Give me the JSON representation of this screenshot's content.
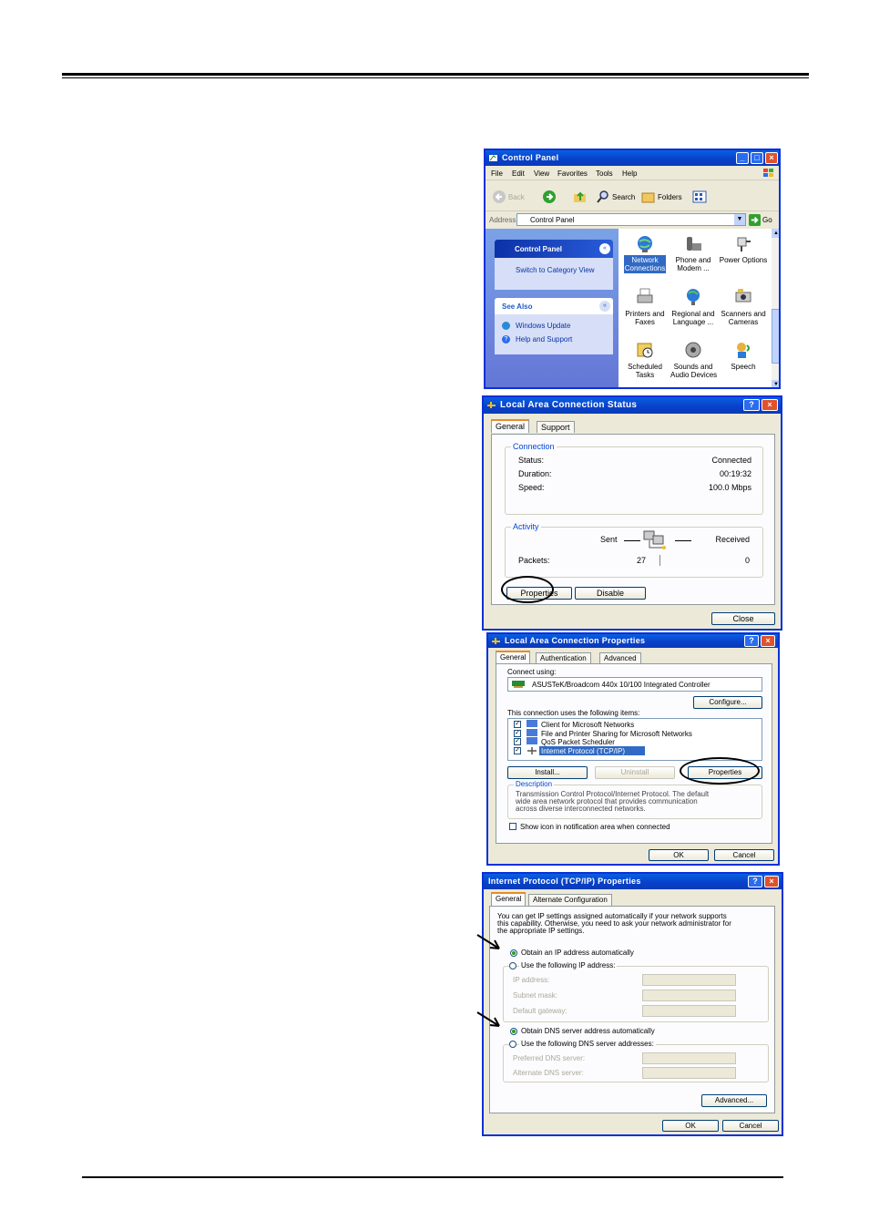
{
  "control_panel": {
    "title": "Control Panel",
    "menu": [
      "File",
      "Edit",
      "View",
      "Favorites",
      "Tools",
      "Help"
    ],
    "toolbar": {
      "back": "Back",
      "search": "Search",
      "folders": "Folders"
    },
    "address_label": "Address",
    "address_value": "Control Panel",
    "go": "Go",
    "side_title": "Control Panel",
    "switch_view": "Switch to Category View",
    "see_also_title": "See Also",
    "see_also": [
      "Windows Update",
      "Help and Support"
    ],
    "items": [
      {
        "line1": "Network",
        "line2": "Connections"
      },
      {
        "line1": "Phone and",
        "line2": "Modem ..."
      },
      {
        "line1": "Power Options",
        "line2": ""
      },
      {
        "line1": "Printers and",
        "line2": "Faxes"
      },
      {
        "line1": "Regional and",
        "line2": "Language ..."
      },
      {
        "line1": "Scanners and",
        "line2": "Cameras"
      },
      {
        "line1": "Scheduled",
        "line2": "Tasks"
      },
      {
        "line1": "Sounds and",
        "line2": "Audio Devices"
      },
      {
        "line1": "Speech",
        "line2": ""
      }
    ]
  },
  "status_dialog": {
    "title": "Local Area Connection Status",
    "tabs": [
      "General",
      "Support"
    ],
    "connection_label": "Connection",
    "status_label": "Status:",
    "status_value": "Connected",
    "duration_label": "Duration:",
    "duration_value": "00:19:32",
    "speed_label": "Speed:",
    "speed_value": "100.0 Mbps",
    "activity_label": "Activity",
    "sent_label": "Sent",
    "received_label": "Received",
    "packets_label": "Packets:",
    "packets_sent": "27",
    "packets_received": "0",
    "properties_button": "Properties",
    "disable_button": "Disable",
    "close_button": "Close"
  },
  "properties_dialog": {
    "title": "Local Area Connection Properties",
    "tabs": [
      "General",
      "Authentication",
      "Advanced"
    ],
    "connect_using_label": "Connect using:",
    "adapter": "ASUSTeK/Broadcom 440x 10/100 Integrated Controller",
    "configure_button": "Configure...",
    "items_label": "This connection uses the following items:",
    "items": [
      "Client for Microsoft Networks",
      "File and Printer Sharing for Microsoft Networks",
      "QoS Packet Scheduler",
      "Internet Protocol (TCP/IP)"
    ],
    "install_button": "Install...",
    "uninstall_button": "Uninstall",
    "properties_button": "Properties",
    "description_label": "Description",
    "description_lines": [
      "Transmission Control Protocol/Internet Protocol. The default",
      "wide area network protocol that provides communication",
      "across diverse interconnected networks."
    ],
    "show_icon_label": "Show icon in notification area when connected",
    "ok_button": "OK",
    "cancel_button": "Cancel"
  },
  "tcpip_dialog": {
    "title": "Internet Protocol (TCP/IP) Properties",
    "tabs": [
      "General",
      "Alternate Configuration"
    ],
    "intro_lines": [
      "You can get IP settings assigned automatically if your network supports",
      "this capability. Otherwise, you need to ask your network administrator for",
      "the appropriate IP settings."
    ],
    "obtain_ip": "Obtain an IP address automatically",
    "use_ip": "Use the following IP address:",
    "ip_label": "IP address:",
    "subnet_label": "Subnet mask:",
    "gateway_label": "Default gateway:",
    "obtain_dns": "Obtain DNS server address automatically",
    "use_dns": "Use the following DNS server addresses:",
    "preferred_dns_label": "Preferred DNS server:",
    "alternate_dns_label": "Alternate DNS server:",
    "advanced_button": "Advanced...",
    "ok_button": "OK",
    "cancel_button": "Cancel"
  }
}
